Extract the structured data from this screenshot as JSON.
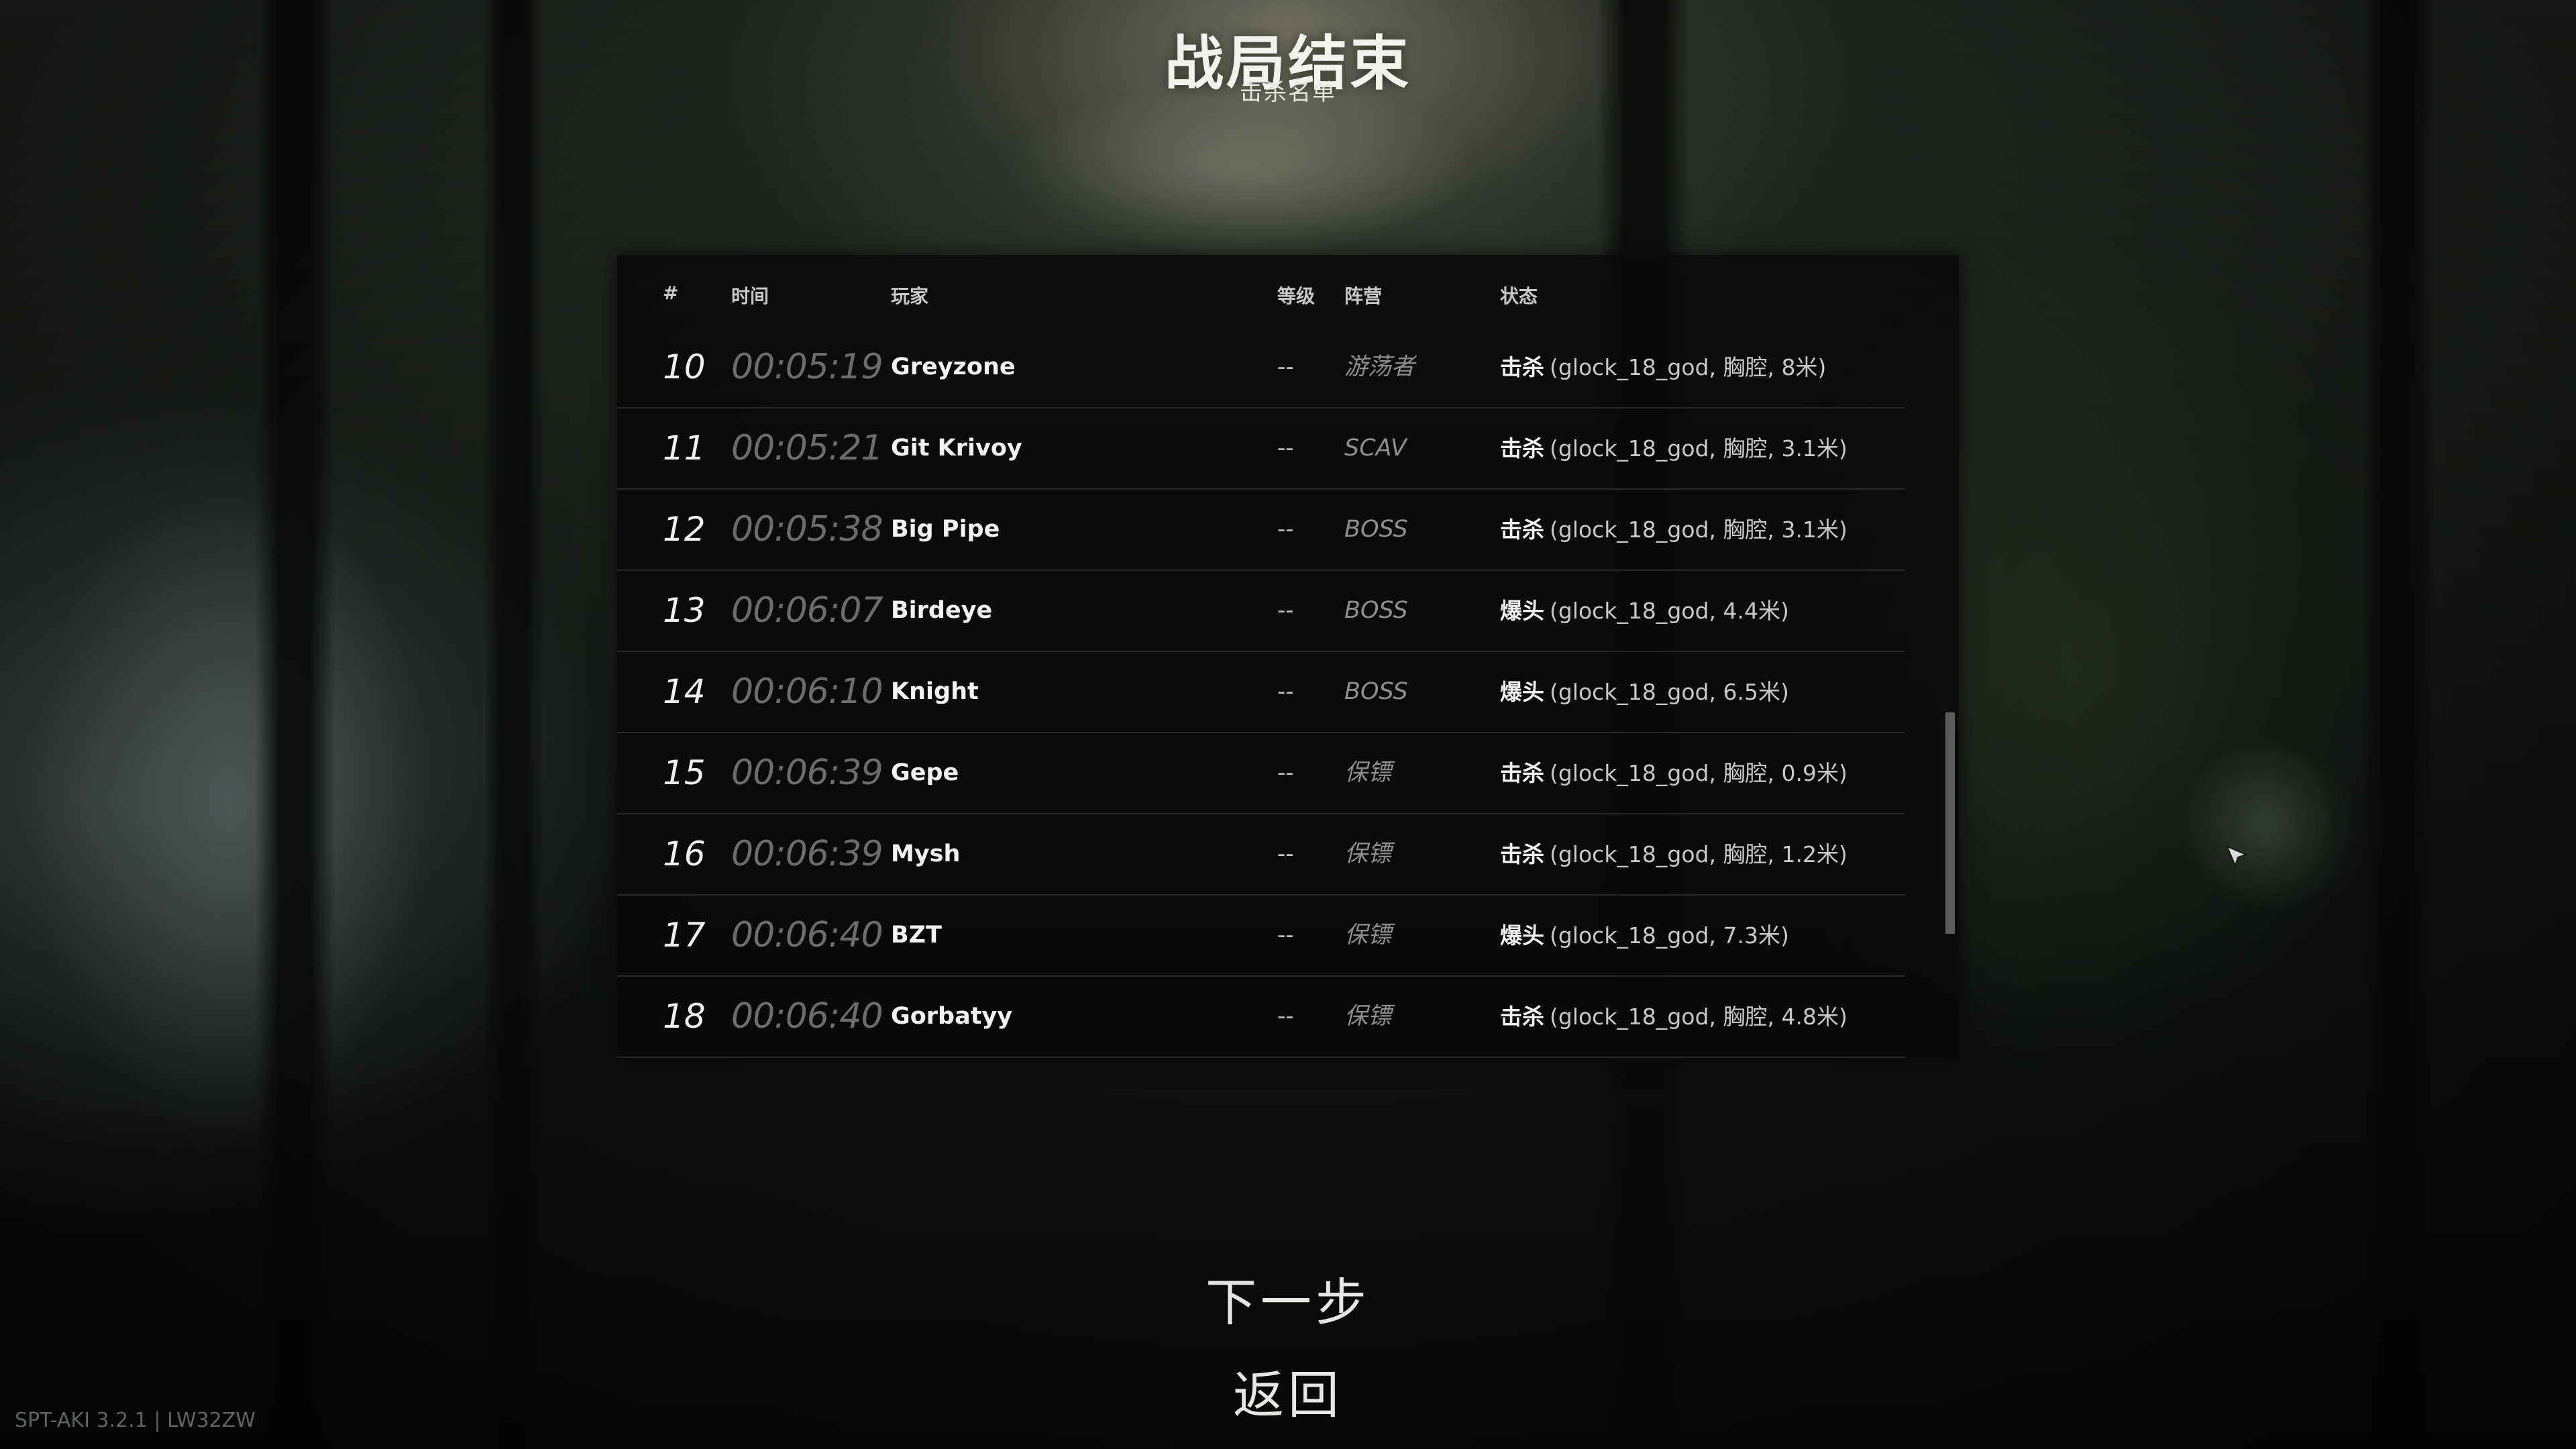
{
  "screen": {
    "title": "战局结束",
    "subtitle": "击杀名单"
  },
  "table": {
    "headers": {
      "num": "#",
      "time": "时间",
      "player": "玩家",
      "level": "等级",
      "side": "阵营",
      "status": "状态"
    },
    "rows": [
      {
        "num": "10",
        "time": "00:05:19",
        "player": "Greyzone",
        "level": "--",
        "side": "游荡者",
        "status_type": "击杀",
        "status_detail": "(glock_18_god, 胸腔, 8米)"
      },
      {
        "num": "11",
        "time": "00:05:21",
        "player": "Git Krivoy",
        "level": "--",
        "side": "SCAV",
        "status_type": "击杀",
        "status_detail": "(glock_18_god, 胸腔, 3.1米)"
      },
      {
        "num": "12",
        "time": "00:05:38",
        "player": "Big Pipe",
        "level": "--",
        "side": "BOSS",
        "status_type": "击杀",
        "status_detail": "(glock_18_god, 胸腔, 3.1米)"
      },
      {
        "num": "13",
        "time": "00:06:07",
        "player": "Birdeye",
        "level": "--",
        "side": "BOSS",
        "status_type": "爆头",
        "status_detail": "(glock_18_god, 4.4米)"
      },
      {
        "num": "14",
        "time": "00:06:10",
        "player": "Knight",
        "level": "--",
        "side": "BOSS",
        "status_type": "爆头",
        "status_detail": "(glock_18_god, 6.5米)"
      },
      {
        "num": "15",
        "time": "00:06:39",
        "player": "Gepe",
        "level": "--",
        "side": "保镖",
        "status_type": "击杀",
        "status_detail": "(glock_18_god, 胸腔, 0.9米)"
      },
      {
        "num": "16",
        "time": "00:06:39",
        "player": "Mysh",
        "level": "--",
        "side": "保镖",
        "status_type": "击杀",
        "status_detail": "(glock_18_god, 胸腔, 1.2米)"
      },
      {
        "num": "17",
        "time": "00:06:40",
        "player": "BZT",
        "level": "--",
        "side": "保镖",
        "status_type": "爆头",
        "status_detail": "(glock_18_god, 7.3米)"
      },
      {
        "num": "18",
        "time": "00:06:40",
        "player": "Gorbatyy",
        "level": "--",
        "side": "保镖",
        "status_type": "击杀",
        "status_detail": "(glock_18_god, 胸腔, 4.8米)"
      }
    ]
  },
  "menu": {
    "next_label": "下一步",
    "back_label": "返回"
  },
  "footer": {
    "version": "SPT-AKI 3.2.1 | LW32ZW"
  },
  "icons": {
    "cursor": "mouse-pointer-icon"
  },
  "colors": {
    "panel_bg": "#080808",
    "row_divider": "#2a2a2a",
    "time_text": "#6c6c6c",
    "side_text": "#8e8e8e"
  }
}
